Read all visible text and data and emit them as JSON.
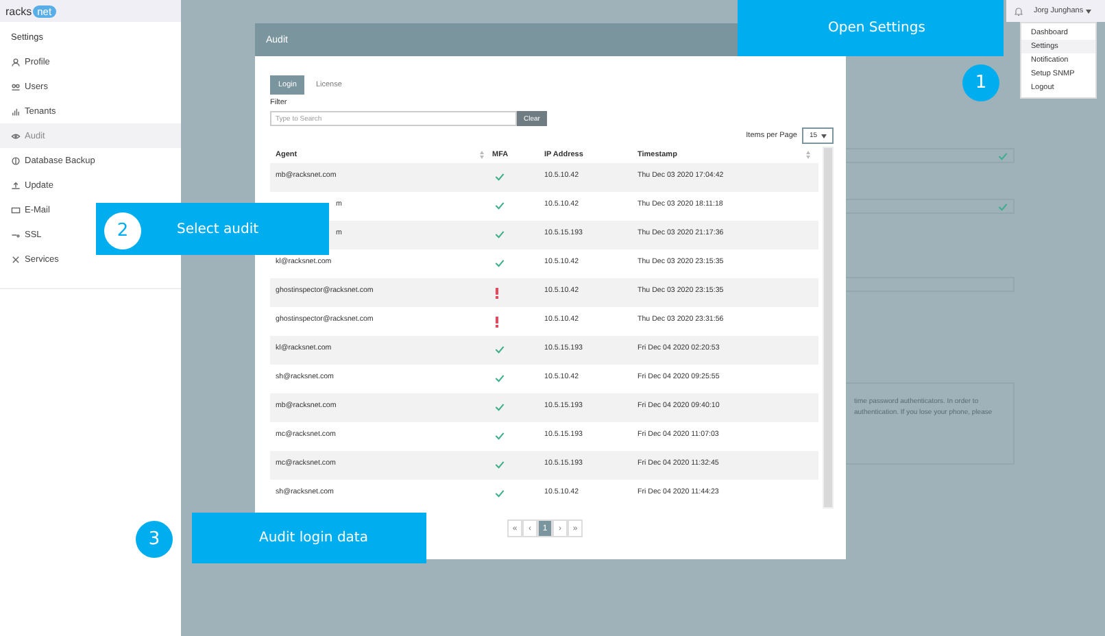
{
  "logo": {
    "left": "racks",
    "right": "net"
  },
  "sidebar": {
    "heading": "Settings",
    "items": [
      {
        "label": "Profile",
        "selected": false
      },
      {
        "label": "Users",
        "selected": false
      },
      {
        "label": "Tenants",
        "selected": false
      },
      {
        "label": "Audit",
        "selected": true
      },
      {
        "label": "Database Backup",
        "selected": false
      },
      {
        "label": "Update",
        "selected": false
      },
      {
        "label": "E-Mail",
        "selected": false
      },
      {
        "label": "SSL",
        "selected": false
      },
      {
        "label": "Services",
        "selected": false
      }
    ]
  },
  "user_menu": {
    "name": "Jorg Junghans",
    "items": [
      {
        "label": "Dashboard",
        "selected": false
      },
      {
        "label": "Settings",
        "selected": true
      },
      {
        "label": "Notification",
        "selected": false
      },
      {
        "label": "Setup SNMP",
        "selected": false
      },
      {
        "label": "Logout",
        "selected": false
      }
    ]
  },
  "background": {
    "notice": [
      "time password authenticators. In order to",
      "authentication. If you lose your phone, please"
    ]
  },
  "modal": {
    "title": "Audit",
    "tabs": [
      {
        "label": "Login",
        "selected": true
      },
      {
        "label": "License",
        "selected": false
      }
    ],
    "filter_label": "Filter",
    "search": {
      "placeholder": "Type to Search"
    },
    "clear": "Clear",
    "items_per_page_label": "Items per Page",
    "items_per_page": "15",
    "columns": [
      "Agent",
      "MFA",
      "IP Address",
      "Timestamp"
    ],
    "rows": [
      {
        "agent": "mb@racksnet.com",
        "mfa": true,
        "ip": "10.5.10.42",
        "timestamp": "Thu Dec 03 2020 17:04:42"
      },
      {
        "agent": "m",
        "agent_cut": true,
        "mfa": true,
        "ip": "10.5.10.42",
        "timestamp": "Thu Dec 03 2020 18:11:18"
      },
      {
        "agent": "m",
        "agent_cut": true,
        "mfa": true,
        "ip": "10.5.15.193",
        "timestamp": "Thu Dec 03 2020 21:17:36"
      },
      {
        "agent": "kl@racksnet.com",
        "mfa": true,
        "ip": "10.5.10.42",
        "timestamp": "Thu Dec 03 2020 23:15:35"
      },
      {
        "agent": "ghostinspector@racksnet.com",
        "mfa": false,
        "ip": "10.5.10.42",
        "timestamp": "Thu Dec 03 2020 23:15:35"
      },
      {
        "agent": "ghostinspector@racksnet.com",
        "mfa": false,
        "ip": "10.5.10.42",
        "timestamp": "Thu Dec 03 2020 23:31:56"
      },
      {
        "agent": "kl@racksnet.com",
        "mfa": true,
        "ip": "10.5.15.193",
        "timestamp": "Fri Dec 04 2020 02:20:53"
      },
      {
        "agent": "sh@racksnet.com",
        "mfa": true,
        "ip": "10.5.10.42",
        "timestamp": "Fri Dec 04 2020 09:25:55"
      },
      {
        "agent": "mb@racksnet.com",
        "mfa": true,
        "ip": "10.5.15.193",
        "timestamp": "Fri Dec 04 2020 09:40:10"
      },
      {
        "agent": "mc@racksnet.com",
        "mfa": true,
        "ip": "10.5.15.193",
        "timestamp": "Fri Dec 04 2020 11:07:03"
      },
      {
        "agent": "mc@racksnet.com",
        "mfa": true,
        "ip": "10.5.15.193",
        "timestamp": "Fri Dec 04 2020 11:32:45"
      },
      {
        "agent": "sh@racksnet.com",
        "mfa": true,
        "ip": "10.5.10.42",
        "timestamp": "Fri Dec 04 2020 11:44:23"
      }
    ],
    "pagination": [
      {
        "label": "«",
        "selected": false
      },
      {
        "label": "‹",
        "selected": false
      },
      {
        "label": "1",
        "selected": true
      },
      {
        "label": "›",
        "selected": false
      },
      {
        "label": "»",
        "selected": false
      }
    ]
  },
  "callouts": [
    {
      "number": "1",
      "text": "Open Settings"
    },
    {
      "number": "2",
      "text": "Select audit"
    },
    {
      "number": "3",
      "text": "Audit login data"
    }
  ]
}
